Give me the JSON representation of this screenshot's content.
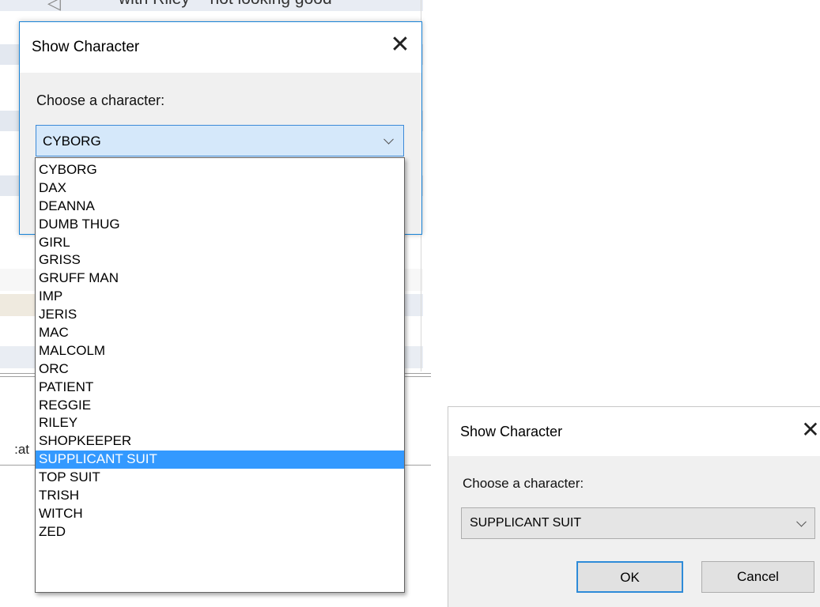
{
  "background": {
    "top_row_text": "with Riley -- not looking good",
    "side_label": "at:"
  },
  "dialog_expanded": {
    "title": "Show Character",
    "close_glyph": "✕",
    "prompt": "Choose a character:",
    "selected_value": "CYBORG",
    "options": [
      "CYBORG",
      "DAX",
      "DEANNA",
      "DUMB THUG",
      "GIRL",
      "GRISS",
      "GRUFF MAN",
      "IMP",
      "JERIS",
      "MAC",
      "MALCOLM",
      "ORC",
      "PATIENT",
      "REGGIE",
      "RILEY",
      "SHOPKEEPER",
      "SUPPLICANT SUIT",
      "TOP SUIT",
      "TRISH",
      "WITCH",
      "ZED"
    ],
    "highlighted_option": "SUPPLICANT SUIT"
  },
  "dialog_result": {
    "title": "Show Character",
    "close_glyph": "✕",
    "prompt": "Choose a character:",
    "selected_value": "SUPPLICANT SUIT",
    "ok_label": "OK",
    "cancel_label": "Cancel"
  },
  "colors": {
    "accent": "#1883d7",
    "selection": "#3399ff",
    "dialog_bg": "#f0f0f0"
  }
}
